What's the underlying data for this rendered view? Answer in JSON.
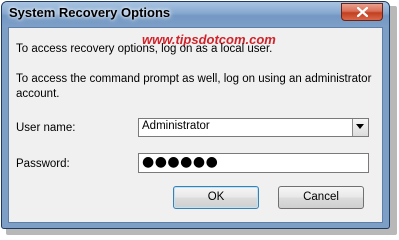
{
  "window": {
    "title": "System Recovery Options"
  },
  "watermark": "www.tipsdotcom.com",
  "messages": {
    "line1": "To access recovery options, log on as a local user.",
    "line2": "To access the command prompt as well, log on using an administrator account."
  },
  "form": {
    "username_label": "User name:",
    "username_value": "Administrator",
    "password_label": "Password:",
    "password_masked": "●●●●●●"
  },
  "buttons": {
    "ok_label": "OK",
    "cancel_label": "Cancel"
  },
  "icons": {
    "close": "close-icon",
    "dropdown": "chevron-down-icon"
  },
  "colors": {
    "titlebar": "#86a8cf",
    "close_button": "#c0401f",
    "watermark": "#d2232a",
    "client_bg": "#f0f0f0"
  }
}
